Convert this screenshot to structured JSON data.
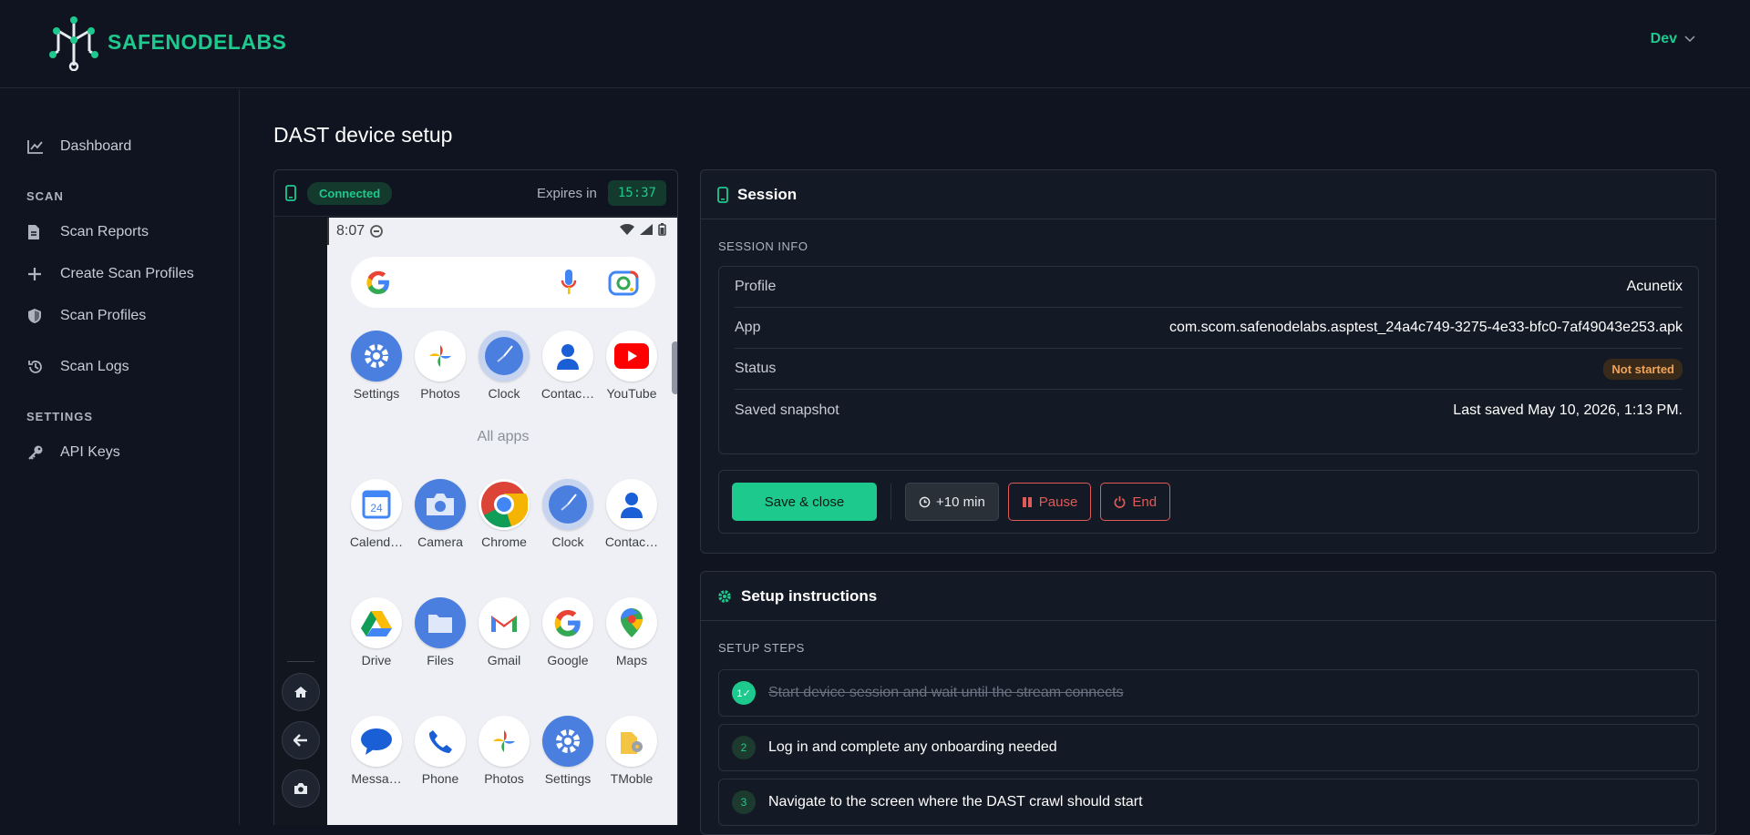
{
  "brand": {
    "name": "SAFENODELABS"
  },
  "user_menu": {
    "label": "Dev"
  },
  "sidebar": {
    "items": [
      {
        "label": "Dashboard"
      },
      {
        "label": "Scan Reports"
      },
      {
        "label": "Create Scan Profiles"
      },
      {
        "label": "Scan Profiles"
      },
      {
        "label": "Scan Logs"
      },
      {
        "label": "API Keys"
      }
    ],
    "sections": {
      "scan": "SCAN",
      "settings": "SETTINGS"
    }
  },
  "page": {
    "title": "DAST device setup"
  },
  "device": {
    "status_badge": "Connected",
    "expires_label": "Expires in",
    "timer": "15:37",
    "phone": {
      "time": "8:07",
      "all_apps_label": "All apps",
      "apps_row1": [
        "Settings",
        "Photos",
        "Clock",
        "Contac…",
        "YouTube"
      ],
      "apps_row2": [
        "Calend…",
        "Camera",
        "Chrome",
        "Clock",
        "Contac…"
      ],
      "apps_row3": [
        "Drive",
        "Files",
        "Gmail",
        "Google",
        "Maps"
      ],
      "apps_row4": [
        "Messa…",
        "Phone",
        "Photos",
        "Settings",
        "TMoble"
      ]
    }
  },
  "session": {
    "title": "Session",
    "info_label": "SESSION INFO",
    "profile_key": "Profile",
    "profile_value": "Acunetix",
    "app_key": "App",
    "app_value": "com.scom.safenodelabs.asptest_24a4c749-3275-4e33-bfc0-7af49043e253.apk",
    "status_key": "Status",
    "status_value": "Not started",
    "snapshot_key": "Saved snapshot",
    "snapshot_value": "Last saved May 10, 2026, 1:13 PM.",
    "save_label": "Save & close",
    "extend_label": "+10 min",
    "pause_label": "Pause",
    "end_label": "End"
  },
  "setup": {
    "title": "Setup instructions",
    "steps_label": "SETUP STEPS",
    "steps": [
      {
        "num": "1✓",
        "text": "Start device session and wait until the stream connects"
      },
      {
        "num": "2",
        "text": "Log in and complete any onboarding needed"
      },
      {
        "num": "3",
        "text": "Navigate to the screen where the DAST crawl should start"
      }
    ]
  },
  "colors": {
    "accent": "#1ec98e",
    "danger": "#e05a57",
    "warning": "#f0a35a",
    "background": "#0f1420"
  }
}
